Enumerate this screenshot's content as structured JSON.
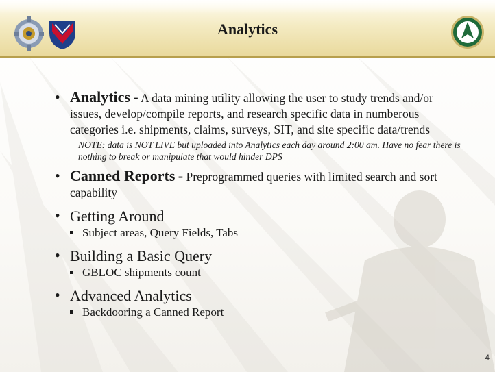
{
  "slide": {
    "title": "Analytics",
    "page_number": "4"
  },
  "bullets": [
    {
      "term": "Analytics",
      "separator": "-",
      "description": "A data mining utility allowing the user to study trends and/or issues, develop/compile reports, and research specific data in numberous categories i.e. shipments, claims, surveys, SIT, and site specific data/trends",
      "note": "NOTE: data is NOT LIVE but uploaded into Analytics each day around 2:00 am. Have no fear there is nothing to break or manipulate that would hinder DPS"
    },
    {
      "term": "Canned Reports",
      "separator": "-",
      "description": "Preprogrammed queries with limited search and sort capability"
    },
    {
      "term": "Getting Around",
      "sub_items": [
        "Subject areas, Query Fields, Tabs"
      ]
    },
    {
      "term": "Building a Basic Query",
      "sub_items": [
        "GBLOC shipments count"
      ]
    },
    {
      "term": "Advanced Analytics",
      "sub_items": [
        "Backdooring a Canned Report"
      ]
    }
  ],
  "icons": {
    "left_logos": [
      "gear-seal-icon",
      "shield-chevron-icon"
    ],
    "right_logo": "compass-arrow-emblem-icon"
  },
  "colors": {
    "header_gold": "#e9d99c",
    "header_border": "#b79f4d",
    "text": "#1a1a1a",
    "emblem_green": "#1f6b3a"
  }
}
